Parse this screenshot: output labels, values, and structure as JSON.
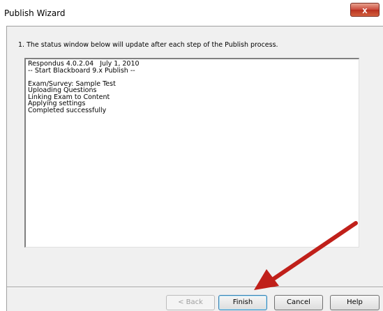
{
  "window": {
    "title": "Publish Wizard",
    "close_label": "x"
  },
  "dialog": {
    "instruction": "1.  The status window below will update after each step of the Publish process.",
    "status_lines": [
      "Respondus 4.0.2.04   July 1, 2010",
      "-- Start Blackboard 9.x Publish --",
      "",
      "Exam/Survey: Sample Test",
      "Uploading Questions",
      "Linking Exam to Content",
      "Applying settings",
      "Completed successfully"
    ]
  },
  "buttons": {
    "back": "< Back",
    "finish": "Finish",
    "cancel": "Cancel",
    "help": "Help"
  },
  "annotation": {
    "arrow_color": "#c0201a",
    "arrow_target": "finish-button"
  }
}
